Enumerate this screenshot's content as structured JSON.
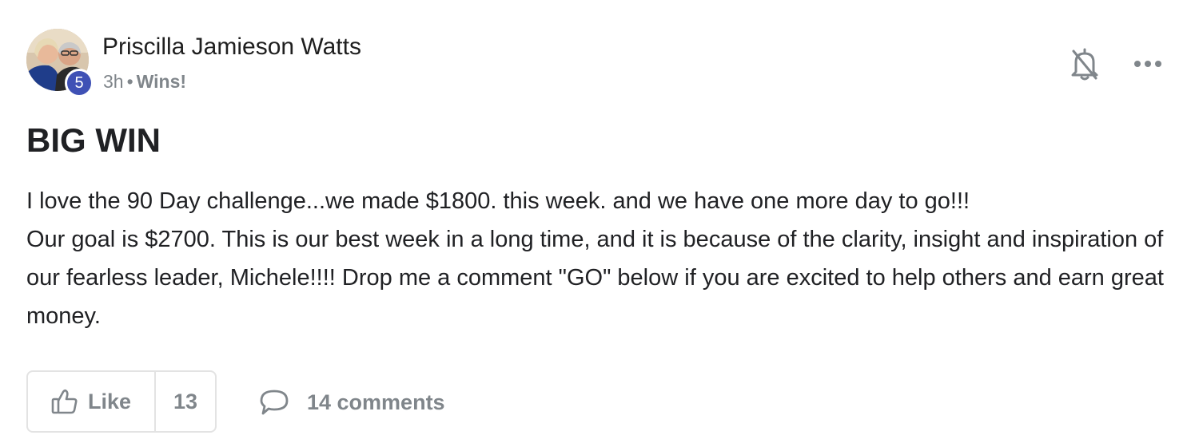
{
  "post": {
    "author": {
      "name": "Priscilla Jamieson Watts",
      "avatar_icon": "user-avatar-photo",
      "level": "5"
    },
    "time": "3h",
    "separator": "•",
    "category": "Wins!",
    "title": "BIG WIN",
    "body": {
      "line1": "I love the 90 Day challenge...we made $1800. this week. and we have one more day to go!!!",
      "line2": "Our goal is $2700. This is our best week in a long time, and it is because of the clarity, insight and inspiration of our fearless leader, Michele!!!! Drop me a comment \"GO\" below if you are excited to help others and earn great money."
    },
    "actions": {
      "like_label": "Like",
      "like_count": "13",
      "comments_label": "14 comments",
      "like_icon": "thumbs-up-icon",
      "comment_icon": "comment-bubble-icon",
      "notify_icon": "bell-off-icon",
      "more_icon": "more-dots-icon"
    }
  },
  "colors": {
    "badge": "#3f51b5",
    "muted_text": "#80868b",
    "border": "#e3e3e3"
  }
}
